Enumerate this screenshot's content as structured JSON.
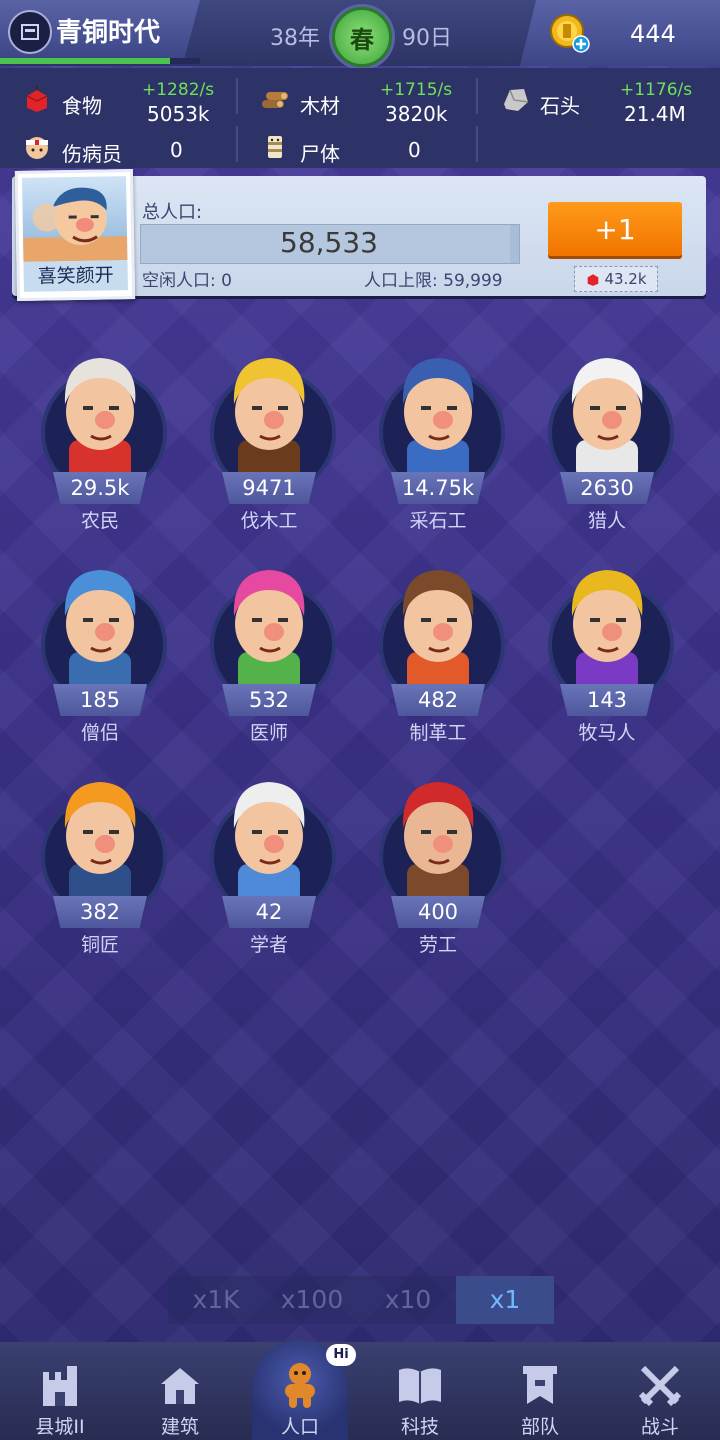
{
  "header": {
    "era_title": "青铜时代",
    "era_progress": 0.85,
    "year": "38年",
    "season": "春",
    "day": "90日",
    "coins": "444"
  },
  "resources": {
    "food": {
      "label": "食物",
      "rate": "+1282/s",
      "total": "5053k"
    },
    "wood": {
      "label": "木材",
      "rate": "+1715/s",
      "total": "3820k"
    },
    "stone": {
      "label": "石头",
      "rate": "+1176/s",
      "total": "21.4M"
    },
    "wounded": {
      "label": "伤病员",
      "total": "0"
    },
    "corpses": {
      "label": "尸体",
      "total": "0"
    }
  },
  "population": {
    "portrait_caption": "喜笑颜开",
    "total_label": "总人口:",
    "total": "58,533",
    "fill_fraction": 0.976,
    "idle": "空闲人口: 0",
    "limit": "人口上限: 59,999",
    "add_button": "+1",
    "cost": "43.2k"
  },
  "jobs": [
    {
      "name": "农民",
      "count": "29.5k"
    },
    {
      "name": "伐木工",
      "count": "9471"
    },
    {
      "name": "采石工",
      "count": "14.75k"
    },
    {
      "name": "猎人",
      "count": "2630"
    },
    {
      "name": "僧侣",
      "count": "185"
    },
    {
      "name": "医师",
      "count": "532"
    },
    {
      "name": "制革工",
      "count": "482"
    },
    {
      "name": "牧马人",
      "count": "143"
    },
    {
      "name": "铜匠",
      "count": "382"
    },
    {
      "name": "学者",
      "count": "42"
    },
    {
      "name": "劳工",
      "count": "400"
    }
  ],
  "multiplier": {
    "options": [
      "x1K",
      "x100",
      "x10",
      "x1"
    ],
    "selected": "x1"
  },
  "nav": {
    "items": [
      {
        "label": "县城II",
        "icon": "castle-icon"
      },
      {
        "label": "建筑",
        "icon": "house-icon"
      },
      {
        "label": "人口",
        "icon": "gingerbread-person-icon"
      },
      {
        "label": "科技",
        "icon": "book-icon"
      },
      {
        "label": "部队",
        "icon": "banner-icon"
      },
      {
        "label": "战斗",
        "icon": "crossed-swords-icon"
      }
    ],
    "badge": "Hi"
  },
  "colors": {
    "accent_orange": "#f07400",
    "rate_green": "#6fe05a",
    "bg_purple": "#3b3188"
  }
}
